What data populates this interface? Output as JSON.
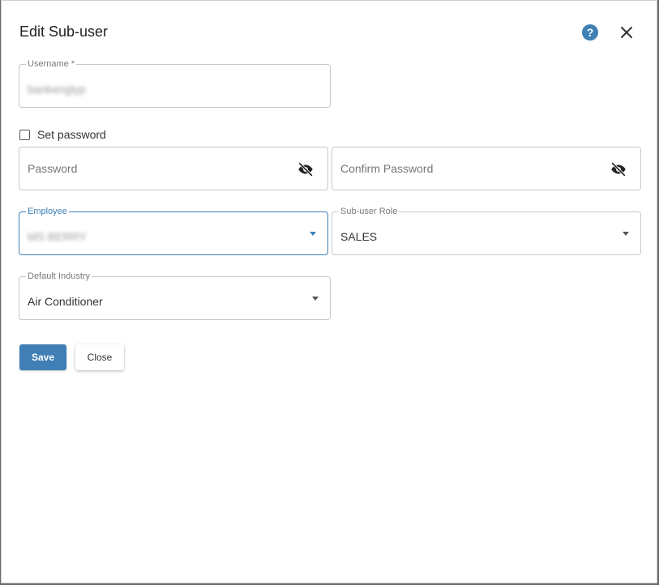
{
  "dialog": {
    "title": "Edit Sub-user",
    "help_icon": "question-circle-icon",
    "close_icon": "close-icon"
  },
  "form": {
    "username": {
      "label": "Username *",
      "value": "bankenglyp"
    },
    "set_password": {
      "label": "Set password",
      "checked": false
    },
    "password": {
      "placeholder": "Password",
      "icon": "eye-off-icon"
    },
    "confirm_password": {
      "placeholder": "Confirm Password",
      "icon": "eye-off-icon"
    },
    "employee": {
      "label": "Employee",
      "value": "MS BERRY"
    },
    "sub_user_role": {
      "label": "Sub-user Role",
      "value": "SALES"
    },
    "default_industry": {
      "label": "Default Industry",
      "value": "Air Conditioner"
    }
  },
  "actions": {
    "save_label": "Save",
    "close_label": "Close"
  },
  "colors": {
    "accent": "#3f7fb5",
    "border": "#c8c8c8",
    "backdrop": "#6b6b6b"
  }
}
